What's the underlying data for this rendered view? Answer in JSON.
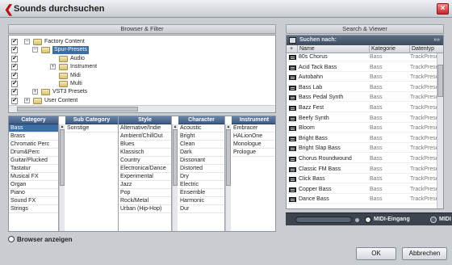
{
  "window": {
    "title": "Sounds durchsuchen",
    "close_glyph": "×"
  },
  "browser_filter": {
    "header": "Browser & Filter",
    "tree": [
      {
        "label": "Factory Content",
        "checked": true,
        "expander": "−",
        "level": 0
      },
      {
        "label": "Spur-Presets",
        "checked": true,
        "expander": "−",
        "level": 1,
        "selected": true
      },
      {
        "label": "Audio",
        "checked": true,
        "expander": "",
        "level": 2
      },
      {
        "label": "Instrument",
        "checked": true,
        "expander": "+",
        "level": 2
      },
      {
        "label": "Midi",
        "checked": true,
        "expander": "",
        "level": 2
      },
      {
        "label": "Multi",
        "checked": true,
        "expander": "",
        "level": 2
      },
      {
        "label": "VST3 Presets",
        "checked": true,
        "expander": "+",
        "level": 1
      },
      {
        "label": "User Content",
        "checked": true,
        "expander": "+",
        "level": 0
      }
    ],
    "columns": {
      "category": {
        "title": "Category",
        "items": [
          "Bass",
          "Brass",
          "Chromatic Perc",
          "Drum&Perc",
          "Guitar/Plucked",
          "Tastatur",
          "Musical FX",
          "Organ",
          "Piano",
          "Sound FX",
          "Strings"
        ],
        "selected": "Bass"
      },
      "sub_category": {
        "title": "Sub Category",
        "items": [
          "Sonstige"
        ]
      },
      "style": {
        "title": "Style",
        "items": [
          "Alternative/Indie",
          "Ambient/ChillOut",
          "Blues",
          "Klassisch",
          "Country",
          "Electronica/Dance",
          "Experimental",
          "Jazz",
          "Pop",
          "Rock/Metal",
          "Urban (Hip-Hop)"
        ]
      },
      "character": {
        "title": "Character",
        "items": [
          "Acoustic",
          "Bright",
          "Clean",
          "Dark",
          "Dissonant",
          "Distorted",
          "Dry",
          "Electric",
          "Ensemble",
          "Harmonic",
          "Dur"
        ]
      },
      "instrument": {
        "title": "Instrument",
        "items": [
          "Embracer",
          "HALionOne",
          "Monologue",
          "Prologue"
        ]
      }
    }
  },
  "search_viewer": {
    "header": "Search & Viewer",
    "search_label": "Suchen nach:",
    "more_glyph": "»»",
    "columns": {
      "icon": "+",
      "name": "Name",
      "category": "Kategorie",
      "type": "Datentyp"
    },
    "rows": [
      {
        "name": "80s Chorus",
        "category": "Bass",
        "type": "TrackPreset"
      },
      {
        "name": "Acid Tack Bass",
        "category": "Bass",
        "type": "TrackPreset"
      },
      {
        "name": "Autobahn",
        "category": "Bass",
        "type": "TrackPreset"
      },
      {
        "name": "Bass Lab",
        "category": "Bass",
        "type": "TrackPreset"
      },
      {
        "name": "Bass Pedal Synth",
        "category": "Bass",
        "type": "TrackPreset"
      },
      {
        "name": "Bazz Fest",
        "category": "Bass",
        "type": "TrackPreset"
      },
      {
        "name": "Beefy Synth",
        "category": "Bass",
        "type": "TrackPreset"
      },
      {
        "name": "Bloom",
        "category": "Bass",
        "type": "TrackPreset"
      },
      {
        "name": "Bright Bass",
        "category": "Bass",
        "type": "TrackPreset"
      },
      {
        "name": "Bright Slap Bass",
        "category": "Bass",
        "type": "TrackPreset"
      },
      {
        "name": "Chorus Roundwound",
        "category": "Bass",
        "type": "TrackPreset"
      },
      {
        "name": "Classic FM Bass",
        "category": "Bass",
        "type": "TrackPreset"
      },
      {
        "name": "Click Bass",
        "category": "Bass",
        "type": "TrackPreset"
      },
      {
        "name": "Copper Bass",
        "category": "Bass",
        "type": "TrackPreset"
      },
      {
        "name": "Dance Bass",
        "category": "Bass",
        "type": "TrackPreset"
      }
    ],
    "midi_in_label": "MIDI-Eingang",
    "midi_o_label": "MIDI"
  },
  "footer": {
    "browser_toggle": "Browser anzeigen",
    "ok": "OK",
    "cancel": "Abbrechen"
  }
}
